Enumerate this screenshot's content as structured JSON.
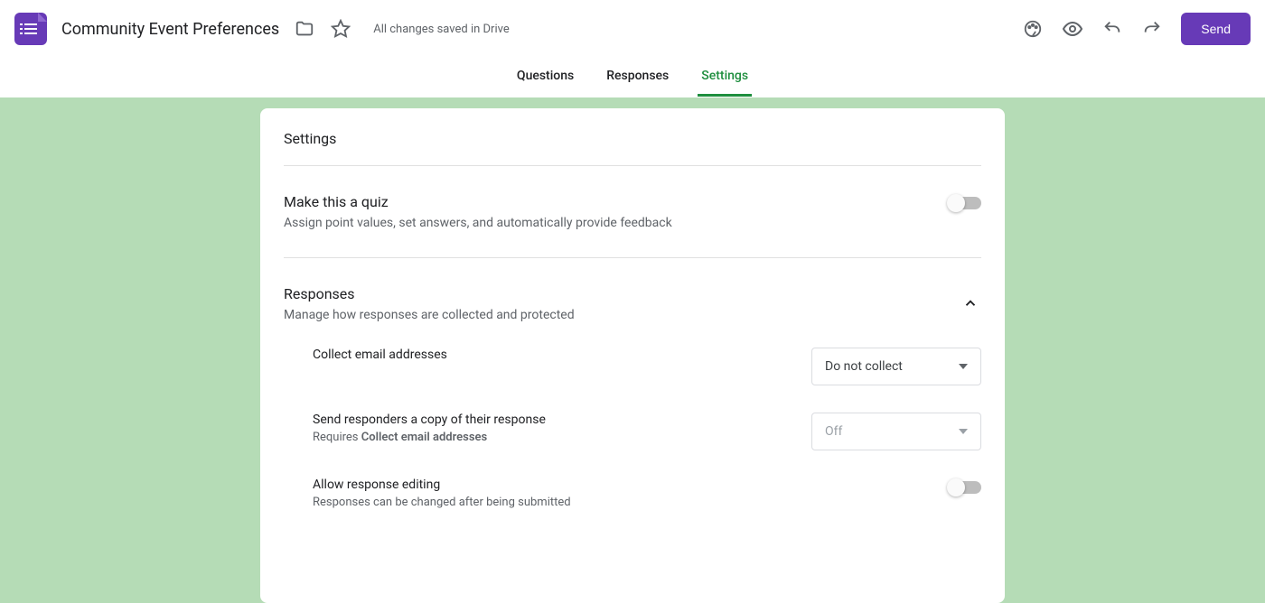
{
  "header": {
    "form_title": "Community Event Preferences",
    "save_status": "All changes saved in Drive",
    "send_label": "Send"
  },
  "tabs": {
    "questions": "Questions",
    "responses": "Responses",
    "settings": "Settings",
    "active": "settings"
  },
  "settings": {
    "title": "Settings",
    "quiz": {
      "heading": "Make this a quiz",
      "sub": "Assign point values, set answers, and automatically provide feedback",
      "on": false
    },
    "responses": {
      "heading": "Responses",
      "sub": "Manage how responses are collected and protected",
      "collect_email": {
        "label": "Collect email addresses",
        "value": "Do not collect"
      },
      "send_copy": {
        "label": "Send responders a copy of their response",
        "requires_prefix": "Requires ",
        "requires_bold": "Collect email addresses",
        "value": "Off"
      },
      "allow_edit": {
        "label": "Allow response editing",
        "sub": "Responses can be changed after being submitted",
        "on": false
      }
    }
  },
  "colors": {
    "accent": "#673ab7",
    "tab_active": "#1e8e3e",
    "canvas": "#b5dcb6"
  }
}
